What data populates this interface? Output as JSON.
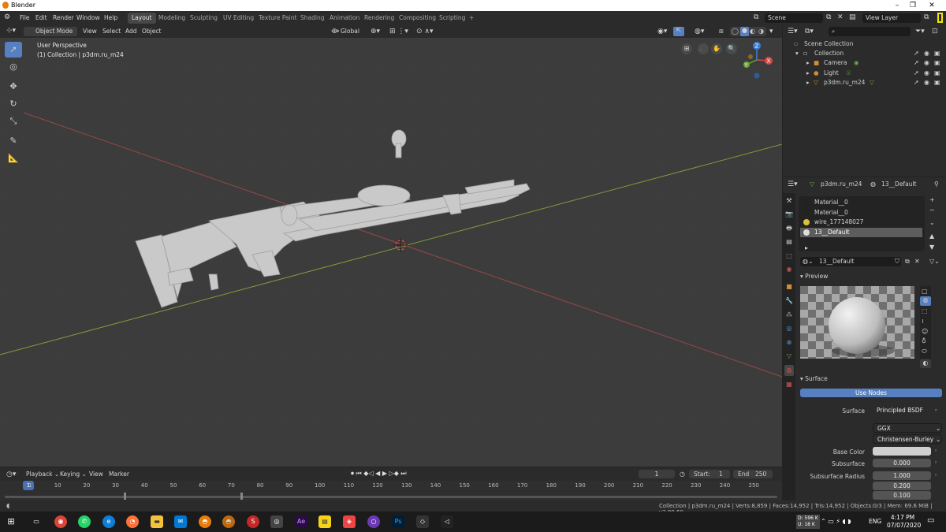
{
  "app": {
    "title": "Blender"
  },
  "topbar": {
    "menus": [
      "File",
      "Edit",
      "Render",
      "Window",
      "Help"
    ],
    "workspaces": [
      "Layout",
      "Modeling",
      "Sculpting",
      "UV Editing",
      "Texture Paint",
      "Shading",
      "Animation",
      "Rendering",
      "Compositing",
      "Scripting"
    ],
    "add_tab": "+",
    "scene": "Scene",
    "view_layer": "View Layer"
  },
  "viewport_header": {
    "mode": "Object Mode",
    "menus": [
      "View",
      "Select",
      "Add",
      "Object"
    ],
    "orientation": "Global"
  },
  "viewport": {
    "perspective": "User Perspective",
    "collection": "(1) Collection | p3dm.ru_m24",
    "gizmo": {
      "x": "X",
      "y": "Y",
      "z": "Z"
    }
  },
  "outliner": {
    "root": "Scene Collection",
    "items": [
      {
        "label": "Collection"
      },
      {
        "label": "Camera"
      },
      {
        "label": "Light"
      },
      {
        "label": "p3dm.ru_m24"
      }
    ]
  },
  "properties": {
    "object": "p3dm.ru_m24",
    "material_header": "13__Default",
    "slots": [
      "Material__0",
      "Material__0",
      "wire_177148027",
      "13__Default"
    ],
    "material_name": "13__Default",
    "preview_label": "Preview",
    "surface_label": "Surface",
    "use_nodes": "Use Nodes",
    "fields": {
      "surface": {
        "label": "Surface",
        "value": "Principled BSDF"
      },
      "distribution": "GGX",
      "sss_method": "Christensen-Burley",
      "base_color": {
        "label": "Base Color"
      },
      "subsurface": {
        "label": "Subsurface",
        "value": "0.000"
      },
      "subsurface_radius": {
        "label": "Subsurface Radius",
        "values": [
          "1.000",
          "0.200",
          "0.100"
        ]
      }
    }
  },
  "timeline": {
    "menus": [
      "Playback",
      "Keying",
      "View",
      "Marker"
    ],
    "current_frame": "1",
    "start_label": "Start:",
    "start": "1",
    "end_label": "End",
    "end": "250",
    "ticks": [
      "1",
      "10",
      "20",
      "30",
      "40",
      "50",
      "60",
      "70",
      "80",
      "90",
      "100",
      "110",
      "120",
      "130",
      "140",
      "150",
      "160",
      "170",
      "180",
      "190",
      "200",
      "210",
      "220",
      "230",
      "240",
      "250"
    ]
  },
  "statusbar": {
    "text": "Collection | p3dm.ru_m24 | Verts:8,859 | Faces:14,952 | Tris:14,952 | Objects:0/3 | Mem: 69.6 MiB | v2.80.60"
  },
  "taskbar": {
    "net_up": "D: 596 K",
    "net_down": "U: 18 K",
    "lang": "ENG",
    "time": "4:17 PM",
    "date": "07/07/2020"
  },
  "colors": {
    "accent": "#5680c2",
    "active_tab": "#474747",
    "background": "#3c3c3c"
  }
}
